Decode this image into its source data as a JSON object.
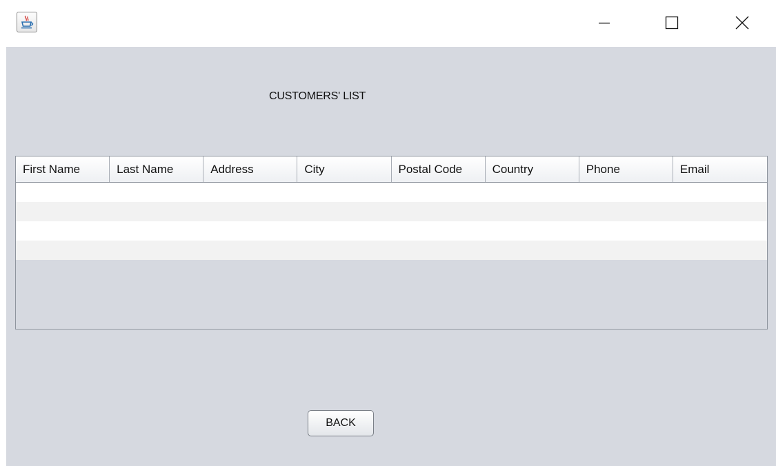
{
  "window": {
    "icon": "java-cup-icon",
    "controls": {
      "minimize_icon": "minimize-icon",
      "maximize_icon": "maximize-icon",
      "close_icon": "close-icon"
    }
  },
  "page": {
    "title": "CUSTOMERS' LIST"
  },
  "table": {
    "columns": [
      "First Name",
      "Last Name",
      "Address",
      "City",
      "Postal Code",
      "Country",
      "Phone",
      "Email"
    ],
    "rows": [
      [
        "",
        "",
        "",
        "",
        "",
        "",
        "",
        ""
      ],
      [
        "",
        "",
        "",
        "",
        "",
        "",
        "",
        ""
      ],
      [
        "",
        "",
        "",
        "",
        "",
        "",
        "",
        ""
      ],
      [
        "",
        "",
        "",
        "",
        "",
        "",
        "",
        ""
      ]
    ]
  },
  "actions": {
    "back_label": "BACK"
  },
  "colors": {
    "panel_background": "#d6d9e0",
    "row_odd": "#ffffff",
    "row_even": "#f2f2f2"
  }
}
